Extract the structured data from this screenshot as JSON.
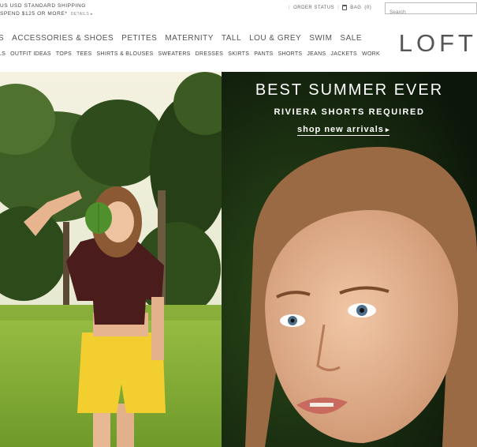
{
  "promo": {
    "line1": "US USD STANDARD SHIPPING",
    "line2": "SPEND $125 OR MORE*",
    "details": "DETAILS ▸"
  },
  "utility": {
    "order_status": "ORDER STATUS",
    "bag": "BAG",
    "bag_count": "(0)"
  },
  "search": {
    "placeholder": "Search"
  },
  "nav": {
    "primary": [
      "S",
      "ACCESSORIES & SHOES",
      "PETITES",
      "MATERNITY",
      "TALL",
      "LOU & GREY",
      "SWIM",
      "SALE"
    ],
    "secondary": [
      "LS",
      "OUTFIT IDEAS",
      "TOPS",
      "TEES",
      "SHIRTS & BLOUSES",
      "SWEATERS",
      "DRESSES",
      "SKIRTS",
      "PANTS",
      "SHORTS",
      "JEANS",
      "JACKETS",
      "WORK"
    ]
  },
  "logo": "LOFT",
  "hero": {
    "headline": "BEST SUMMER EVER",
    "subhead": "RIVIERA SHORTS REQUIRED",
    "cta": "shop new arrivals"
  },
  "colors": {
    "hero_right_bg": "#0f1a0d",
    "shorts": "#f2cf2e",
    "top": "#4a1c1c",
    "grass": "#8fb53a"
  }
}
